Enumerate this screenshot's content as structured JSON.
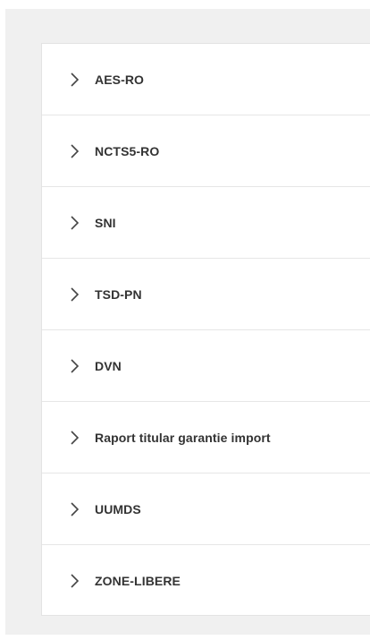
{
  "accordion": {
    "items": [
      {
        "label": "AES-RO",
        "icon": "chevron-right-icon"
      },
      {
        "label": "NCTS5-RO",
        "icon": "chevron-right-icon"
      },
      {
        "label": "SNI",
        "icon": "chevron-right-icon"
      },
      {
        "label": "TSD-PN",
        "icon": "chevron-right-icon"
      },
      {
        "label": "DVN",
        "icon": "chevron-right-icon"
      },
      {
        "label": "Raport titular garantie import",
        "icon": "chevron-right-icon"
      },
      {
        "label": "UUMDS",
        "icon": "chevron-right-icon"
      },
      {
        "label": "ZONE-LIBERE",
        "icon": "chevron-right-icon"
      }
    ]
  },
  "colors": {
    "page_background": "#f0f0f0",
    "panel_background": "#ffffff",
    "divider": "#e6e6e6",
    "text": "#333333"
  }
}
